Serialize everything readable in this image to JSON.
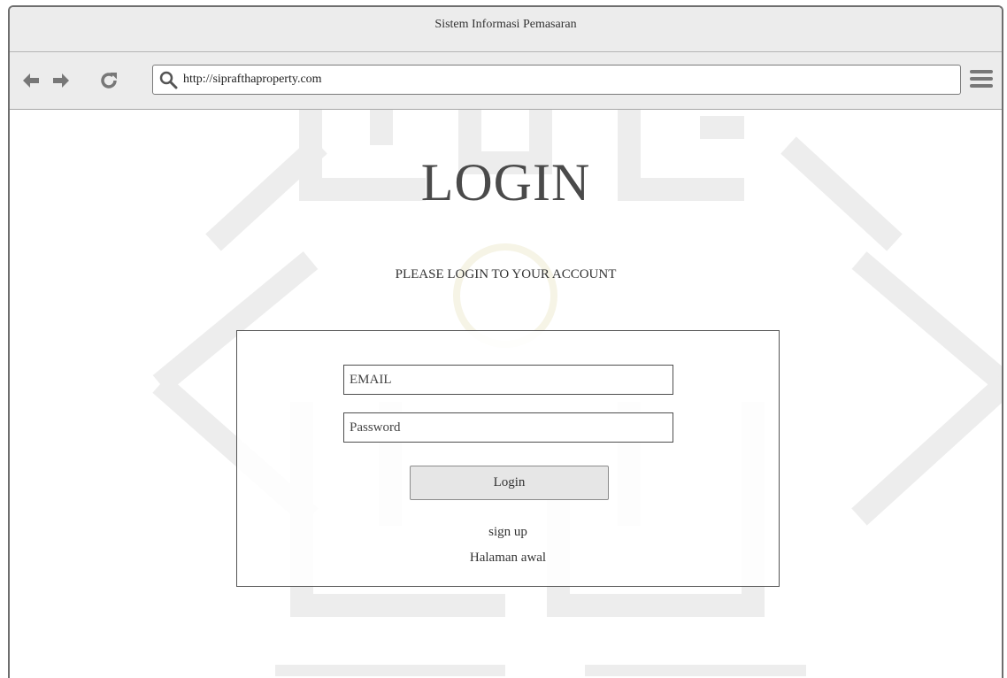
{
  "window": {
    "title": "Sistem Informasi Pemasaran"
  },
  "toolbar": {
    "back_icon": "arrow-left-icon",
    "forward_icon": "arrow-right-icon",
    "reload_icon": "reload-icon",
    "url": "http://siprafthaproperty.com",
    "menu_icon": "hamburger-menu-icon"
  },
  "page": {
    "heading": "LOGIN",
    "subheading": "PLEASE LOGIN TO YOUR ACCOUNT",
    "form": {
      "email_placeholder": "EMAIL",
      "password_placeholder": "Password",
      "submit_label": "Login",
      "signup_link": "sign up",
      "home_link": "Halaman awal"
    }
  },
  "colors": {
    "chrome_bg": "#ececec",
    "border": "#6e6e6e",
    "text": "#333333",
    "button_bg": "#e6e6e6"
  }
}
